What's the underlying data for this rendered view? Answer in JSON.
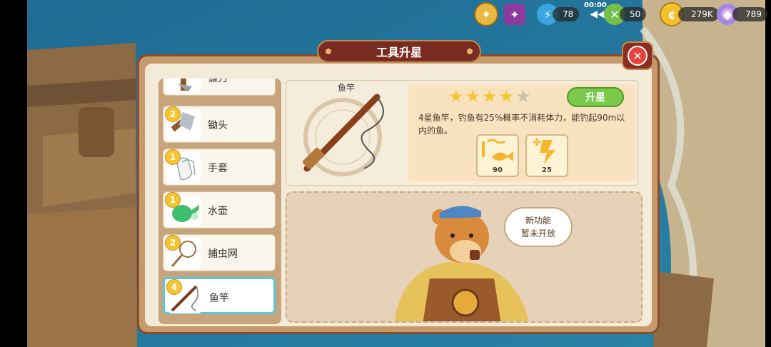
{
  "hud": {
    "energy_value": "78",
    "timer": "00:00",
    "stamina_value": "50",
    "coins_value": "279K",
    "gems_value": "789"
  },
  "panel": {
    "title": "工具升星",
    "close_icon": "close-x"
  },
  "tools": [
    {
      "name": "镰刀",
      "level": "",
      "selected": false
    },
    {
      "name": "锄头",
      "level": "2",
      "selected": false
    },
    {
      "name": "手套",
      "level": "1",
      "selected": false
    },
    {
      "name": "水壶",
      "level": "1",
      "selected": false
    },
    {
      "name": "捕虫网",
      "level": "2",
      "selected": false
    },
    {
      "name": "鱼竿",
      "level": "4",
      "selected": true
    }
  ],
  "detail": {
    "tool_name": "鱼竿",
    "stars_filled": 4,
    "stars_total": 5,
    "upgrade_label": "升星",
    "description": "4星鱼竿，钓鱼有25%概率不消耗体力，能钓起90m以内的鱼。",
    "badges": [
      {
        "icon": "fish-depth-icon",
        "value": "90"
      },
      {
        "icon": "stamina-save-icon",
        "value": "25"
      }
    ]
  },
  "notice": {
    "line1": "新功能",
    "line2": "暂未开放"
  },
  "colors": {
    "panel_border": "#8a4a2c",
    "title_plate": "#7a2c22",
    "upgrade_green": "#7bc94a",
    "selected_outline": "#5ac8d8",
    "star_gold": "#f5c531"
  }
}
